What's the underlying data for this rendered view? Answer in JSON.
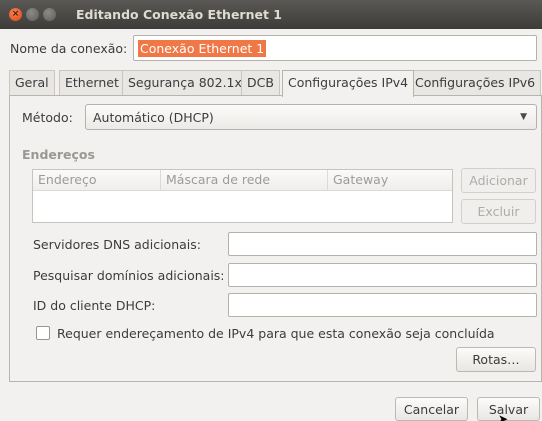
{
  "window": {
    "title": "Editando Conexão Ethernet 1"
  },
  "connection_name": {
    "label": "Nome da conexão:",
    "value": "Conexão Ethernet 1"
  },
  "tabs": [
    {
      "label": "Geral"
    },
    {
      "label": "Ethernet"
    },
    {
      "label": "Segurança 802.1x"
    },
    {
      "label": "DCB"
    },
    {
      "label": "Configurações IPv4"
    },
    {
      "label": "Configurações IPv6"
    }
  ],
  "ipv4": {
    "method_label": "Método:",
    "method_value": "Automático (DHCP)",
    "addresses_title": "Endereços",
    "columns": [
      "Endereço",
      "Máscara de rede",
      "Gateway"
    ],
    "add_button": "Adicionar",
    "remove_button": "Excluir",
    "dns_label": "Servidores DNS adicionais:",
    "search_domains_label": "Pesquisar domínios adicionais:",
    "dhcp_client_id_label": "ID do cliente DHCP:",
    "require_ipv4_label": "Requer endereçamento de IPv4 para que esta conexão seja concluída",
    "routes_button": "Rotas…"
  },
  "footer": {
    "cancel_button": "Cancelar",
    "save_button": "Salvar"
  },
  "colors": {
    "accent": "#f07746",
    "titlebar": "#3d3c38"
  }
}
